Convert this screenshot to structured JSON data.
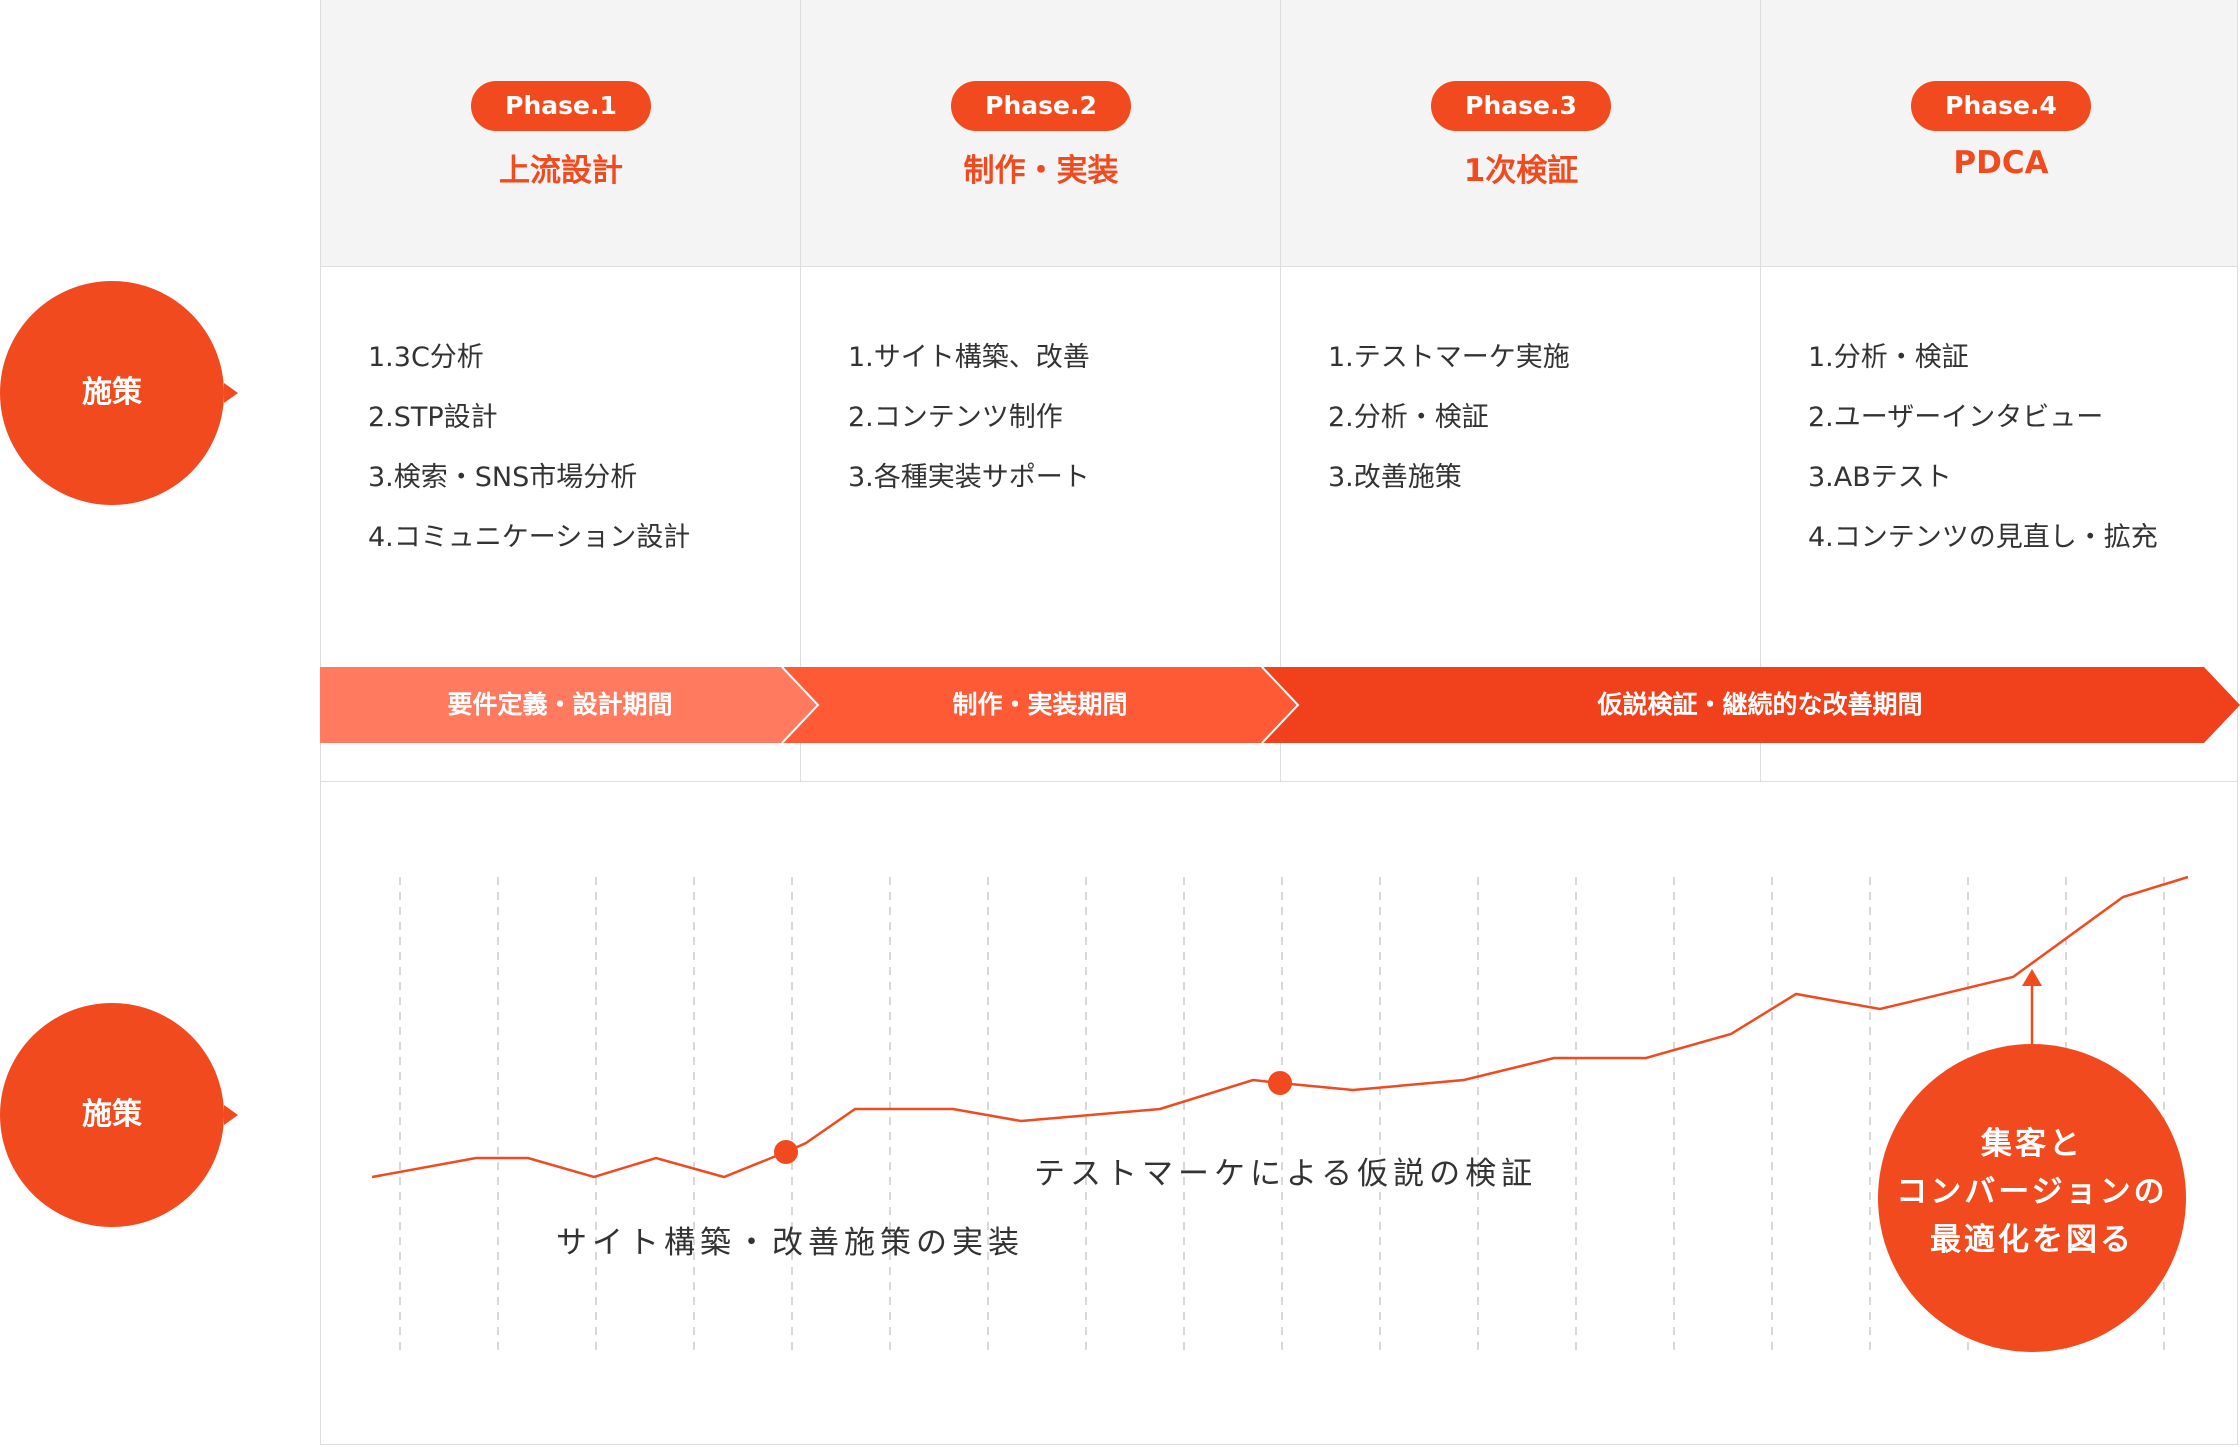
{
  "side_labels": [
    "施策",
    "施策"
  ],
  "phases": [
    {
      "badge": "Phase.1",
      "title": "上流設計",
      "items": [
        "1.3C分析",
        "2.STP設計",
        "3.検索・SNS市場分析",
        "4.コミュニケーション設計"
      ]
    },
    {
      "badge": "Phase.2",
      "title": "制作・実装",
      "items": [
        "1.サイト構築、改善",
        "2.コンテンツ制作",
        "3.各種実装サポート"
      ]
    },
    {
      "badge": "Phase.3",
      "title": "1次検証",
      "items": [
        "1.テストマーケ実施",
        "2.分析・検証",
        "3.改善施策"
      ]
    },
    {
      "badge": "Phase.4",
      "title": "PDCA",
      "items": [
        "1.分析・検証",
        "2.ユーザーインタビュー",
        "3.ABテスト",
        "4.コンテンツの見直し・拡充"
      ]
    }
  ],
  "period_bands": [
    {
      "label": "要件定義・設計期間"
    },
    {
      "label": "制作・実装期間"
    },
    {
      "label": "仮説検証・継続的な改善期間"
    }
  ],
  "chart": {
    "milestone_1": "サイト構築・改善施策の実装",
    "milestone_2": "テストマーケによる仮説の検証",
    "goal_lines": [
      "集客と",
      "コンバージョンの",
      "最適化を図る"
    ]
  },
  "colors": {
    "accent": "#f04a1e",
    "band_1": "#ff7a5e",
    "band_2": "#ff5a36",
    "band_3": "#f0401c",
    "header_bg": "#f4f4f4",
    "line": "#dddddd"
  }
}
